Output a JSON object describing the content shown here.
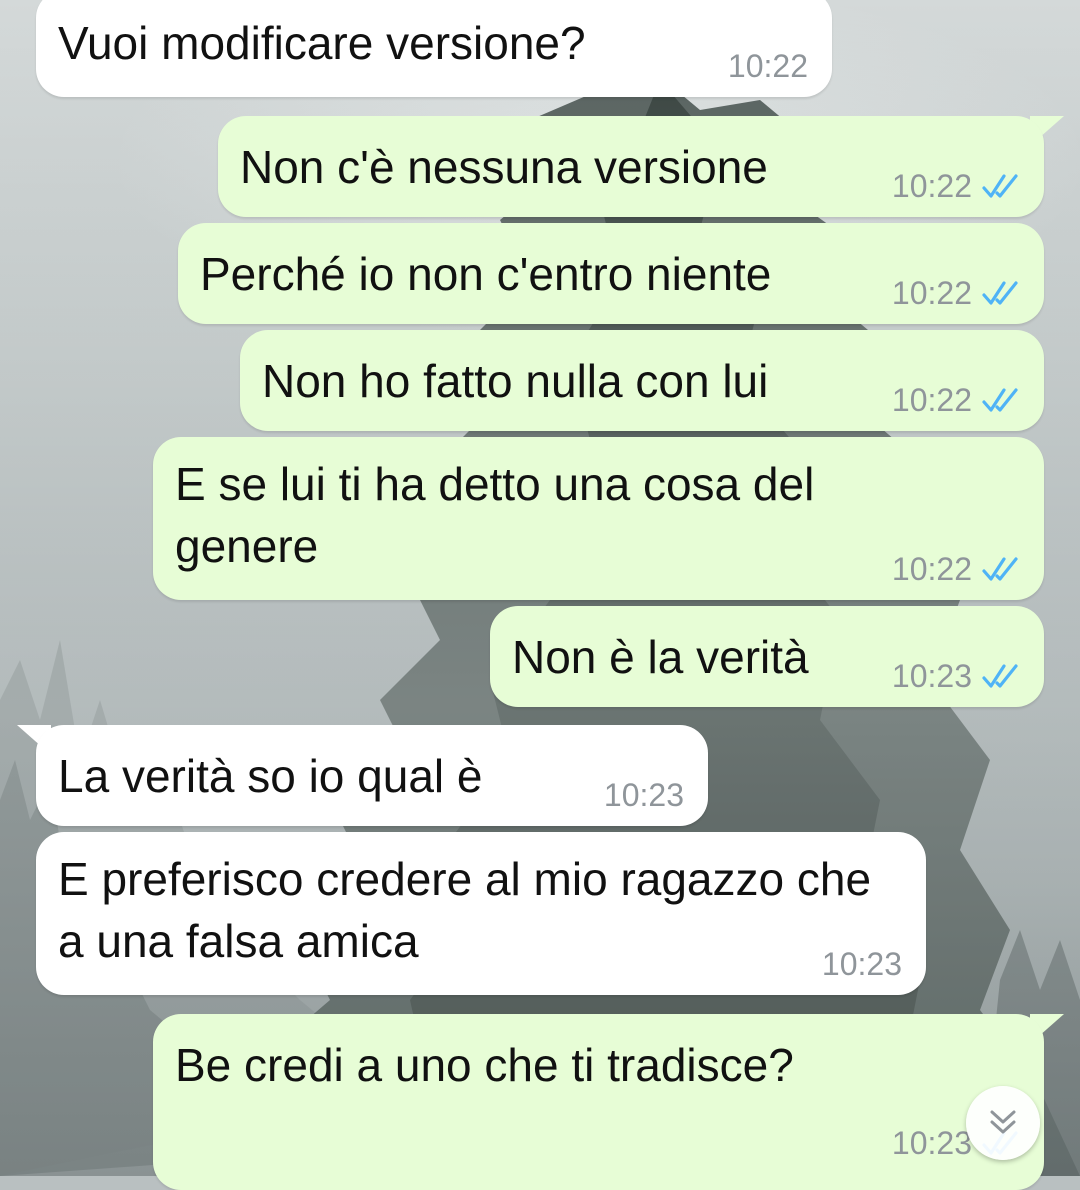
{
  "chat": {
    "messages": [
      {
        "direction": "incoming",
        "text": "Vuoi modificare versione?",
        "time": "10:22"
      },
      {
        "direction": "outgoing",
        "text": "Non c'è nessuna versione",
        "time": "10:22",
        "status": "read-ticks-icon"
      },
      {
        "direction": "outgoing",
        "text": "Perché io non c'entro niente",
        "time": "10:22",
        "status": "read-ticks-icon"
      },
      {
        "direction": "outgoing",
        "text": "Non ho fatto nulla con lui",
        "time": "10:22",
        "status": "read-ticks-icon"
      },
      {
        "direction": "outgoing",
        "text": "E se lui ti ha detto una cosa del genere",
        "time": "10:22",
        "status": "read-ticks-icon"
      },
      {
        "direction": "outgoing",
        "text": "Non è la verità",
        "time": "10:23",
        "status": "read-ticks-icon"
      },
      {
        "direction": "incoming",
        "text": "La verità so io qual è",
        "time": "10:23"
      },
      {
        "direction": "incoming",
        "text": "E preferisco credere al mio ragazzo che a una falsa amica",
        "time": "10:23"
      },
      {
        "direction": "outgoing",
        "text": "Be credi a uno che ti tradisce?",
        "time": "10:23",
        "status": "read-ticks-icon"
      }
    ],
    "scroll_button_icon": "double-chevron-down-icon"
  },
  "colors": {
    "incoming_bubble": "#ffffff",
    "outgoing_bubble": "#e7fdd6",
    "timestamp": "#8f959a",
    "read_ticks": "#4fb3f6"
  }
}
